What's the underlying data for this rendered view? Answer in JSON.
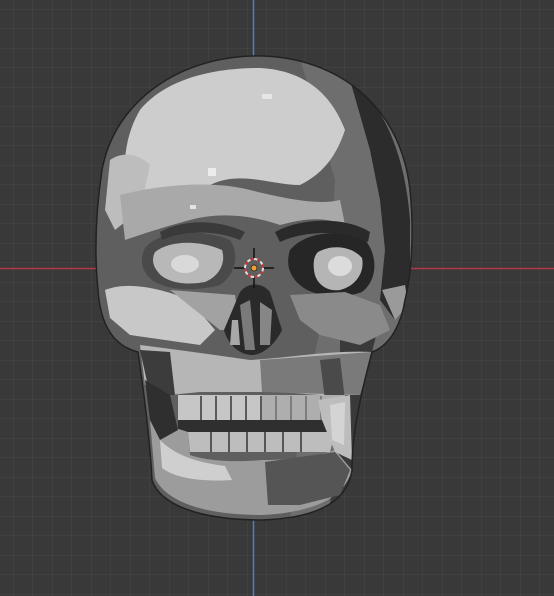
{
  "viewport": {
    "background_color": "#393939",
    "grid_color": "#474747",
    "x_axis_color": "#b0384a",
    "y_axis_color": "#4a7fcc",
    "object": "skull-mesh",
    "shading": "toon-gray",
    "cursor_icon": "3d-cursor-icon",
    "origin_icon": "object-origin-icon"
  }
}
